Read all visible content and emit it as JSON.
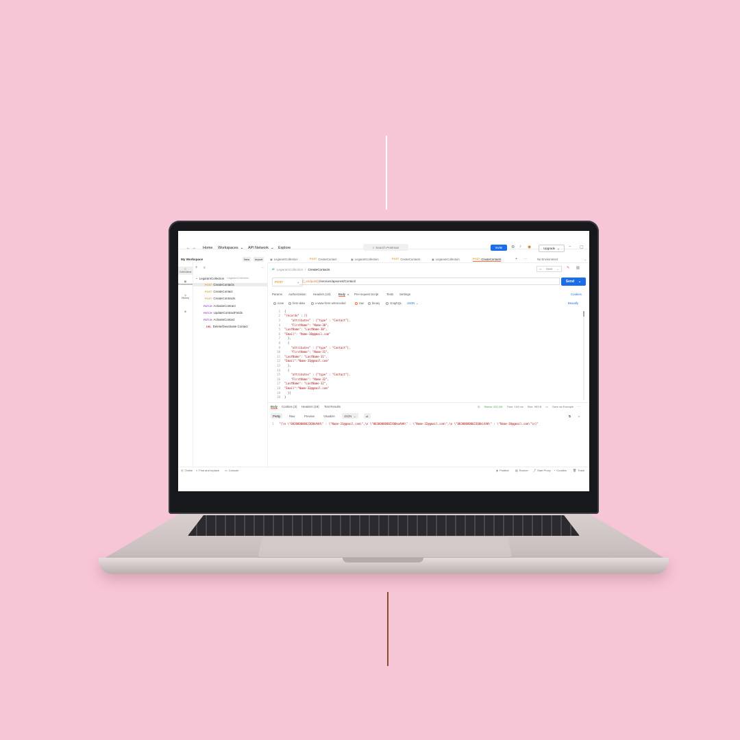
{
  "topbar": {
    "home": "Home",
    "workspaces": "Workspaces",
    "api_network": "API Network",
    "explore": "Explore",
    "search_placeholder": "Search Postman",
    "invite": "Invite",
    "upgrade": "Upgrade"
  },
  "workspace": {
    "name": "My Workspace",
    "new_label": "New",
    "import_label": "Import"
  },
  "tabs": [
    {
      "method": "",
      "label": "LegaramCollection"
    },
    {
      "method": "POST",
      "label": "CreateContact"
    },
    {
      "method": "",
      "label": "LegaramCollection"
    },
    {
      "method": "POST",
      "label": "CreateContacts"
    },
    {
      "method": "",
      "label": "LegaramCollection"
    },
    {
      "method": "POST",
      "label": "CreateContacts"
    }
  ],
  "environment": "No Environment",
  "rail": [
    "Collections",
    "Environments",
    "History"
  ],
  "collection": {
    "name": "LegaramCollection",
    "badge": "LegaramCollection",
    "items": [
      {
        "method": "POST",
        "label": "CreateContacts"
      },
      {
        "method": "POST",
        "label": "CreateContact"
      },
      {
        "method": "POST",
        "label": "CreateContracts"
      },
      {
        "method": "PATCH",
        "label": "ActivateContract"
      },
      {
        "method": "PATCH",
        "label": "UpdateContractFields"
      },
      {
        "method": "PATCH",
        "label": "ActivateContact"
      },
      {
        "method": "DEL",
        "label": "Delete/Deactivate Contact"
      }
    ]
  },
  "request": {
    "breadcrumb_parent": "LegaramCollection",
    "breadcrumb_current": "CreateContacts",
    "save": "Save",
    "method": "POST",
    "url_var": "{{_endpoint}}",
    "url_path": "/services/apexrest/Contact/",
    "send": "Send",
    "tabs": [
      "Params",
      "Authorization",
      "Headers (10)",
      "Body",
      "Pre-request Script",
      "Tests",
      "Settings"
    ],
    "cookies": "Cookies",
    "body_types": [
      "none",
      "form-data",
      "x-www-form-urlencoded",
      "raw",
      "binary",
      "GraphQL"
    ],
    "body_format": "JSON",
    "beautify": "Beautify",
    "code": [
      "{",
      "\"records\" : [{",
      "    \"attributes\" : {\"type\" : \"Contact\"},",
      "    \"FirstName\": \"Name-30\",",
      "\"LastName\": \"LastName-30\",",
      "\"Email\": \"Name-30@gmail.com\"",
      "  },",
      "  {",
      "    \"attributes\" : {\"type\" : \"Contact\"},",
      "    \"FirstName\": \"Name-31\",",
      "\"LastName\": \"LastName-31\",",
      "\"Email\":\"Name-31@gmail.com\"",
      "  },",
      "  {",
      "    \"attributes\" : {\"type\" : \"Contact\"},",
      "    \"FirstName\": \"Name-32\",",
      "\"LastName\": \"LastName-32\",",
      "\"Email\":\"Name-32@gmail.com\"",
      "  }]",
      "}"
    ]
  },
  "response": {
    "tabs": [
      "Body",
      "Cookies (3)",
      "Headers (19)",
      "Test Results"
    ],
    "status": "Status: 200 OK",
    "time": "Time: 104 ms",
    "size": "Size: 953 B",
    "save_example": "Save as Example",
    "views": [
      "Pretty",
      "Raw",
      "Preview",
      "Visualize"
    ],
    "format": "JSON",
    "line_no": "1",
    "body": "\"[\\n \\\"003000000023Q0kAAH\\\" : \\\"Name-31@gmail.com\\\",\\n \\\"003000000023Q0kaAAH\\\" : \\\"Name-32@gmail.com\\\",\\n \\\"003000000023Q0kiAAH\\\" : \\\"Name-30@gmail.com\\\"\\n]\""
  },
  "statusbar": {
    "online": "Online",
    "find": "Find and replace",
    "console": "Console",
    "postbot": "Postbot",
    "runner": "Runner",
    "proxy": "Start Proxy",
    "cookies": "Cookies",
    "trash": "Trash"
  },
  "colors": {
    "background": "#f7c6d6",
    "accent": "#ff6c37",
    "send": "#1c6ee8",
    "post": "#e6a23c",
    "patch": "#a056c7"
  }
}
